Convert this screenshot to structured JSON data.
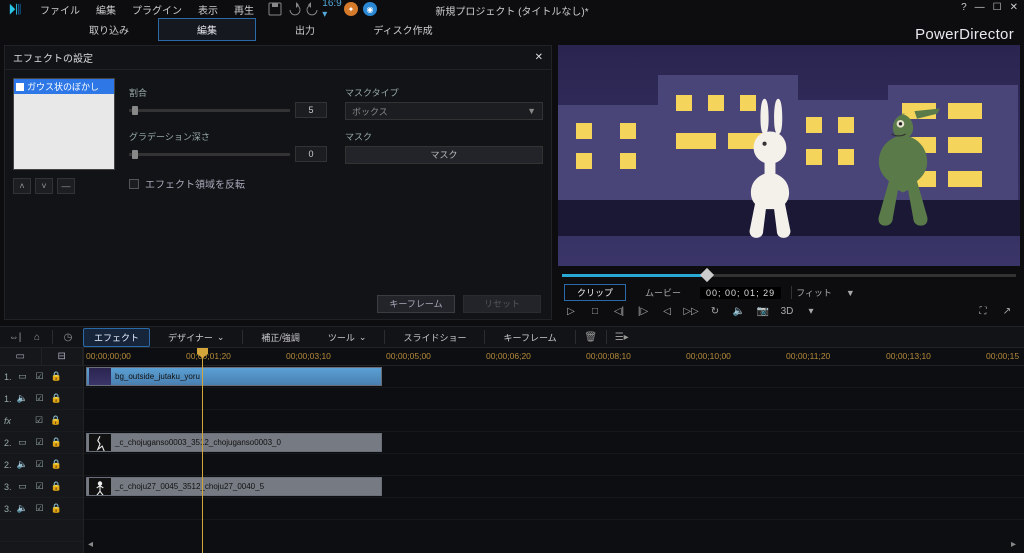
{
  "menu": {
    "file": "ファイル",
    "edit": "編集",
    "plugin": "プラグイン",
    "view": "表示",
    "play": "再生"
  },
  "title": "新規プロジェクト (タイトルなし)*",
  "brand": "PowerDirector",
  "tabs": {
    "capture": "取り込み",
    "edit": "編集",
    "output": "出力",
    "disc": "ディスク作成"
  },
  "fx": {
    "header": "エフェクトの設定",
    "item": "ガウス状のぼかし",
    "ratio": "割合",
    "ratio_val": "5",
    "masktype": "マスクタイプ",
    "masktype_val": "ボックス",
    "grad": "グラデーション深さ",
    "grad_val": "0",
    "mask": "マスク",
    "mask_btn": "マスク",
    "invert": "エフェクト領域を反転",
    "keyframe_btn": "キーフレーム",
    "reset_btn": "リセット"
  },
  "preview": {
    "clip": "クリップ",
    "movie": "ムービー",
    "timecode": "00; 00; 01; 29",
    "fit": "フィット",
    "threeD": "3D"
  },
  "tl_toolbar": {
    "effect": "エフェクト",
    "designer": "デザイナー",
    "correct": "補正/強調",
    "tool": "ツール",
    "slideshow": "スライドショー",
    "keyframe": "キーフレーム"
  },
  "ruler": [
    "00;00;00;00",
    "00;00;01;20",
    "00;00;03;10",
    "00;00;05;00",
    "00;00;06;20",
    "00;00;08;10",
    "00;00;10;00",
    "00;00;11;20",
    "00;00;13;10",
    "00;00;15"
  ],
  "tracks": {
    "r1": "1.",
    "r2": "1.",
    "fx": "fx",
    "r3": "2.",
    "r4": "2.",
    "r5": "3.",
    "r6": "3."
  },
  "clips": {
    "c1": "bg_outside_jutaku_yoru",
    "c2": "_c_chojuganso0003_3512_chojuganso0003_0",
    "c3": "_c_choju27_0045_3512_choju27_0040_5"
  }
}
